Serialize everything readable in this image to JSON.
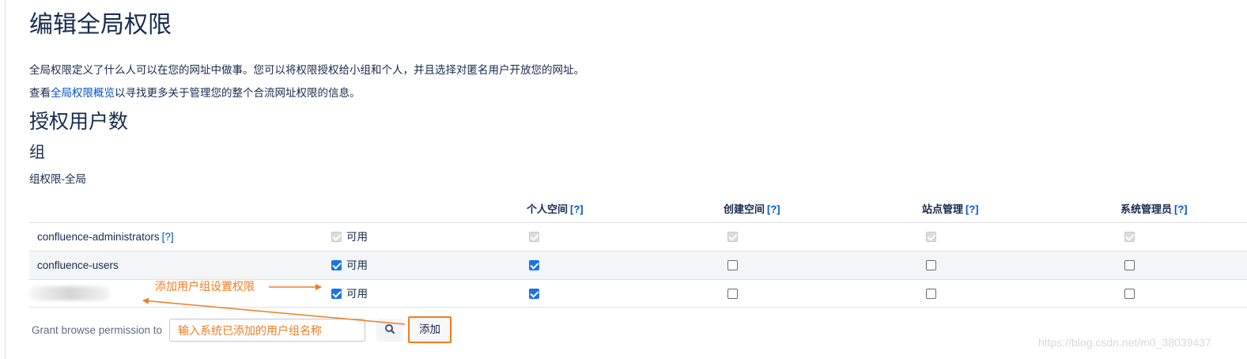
{
  "page": {
    "title": "编辑全局权限",
    "desc1": "全局权限定义了什么人可以在您的网址中做事。您可以将权限授权给小组和个人，并且选择对匿名用户开放您的网址。",
    "desc2_prefix": "查看",
    "desc2_link": "全局权限概览",
    "desc2_suffix": "以寻找更多关于管理您的整个合流网址权限的信息。",
    "section_title": "授权用户数",
    "group_title": "组",
    "group_subtitle": "组权限-全局"
  },
  "columns": [
    {
      "label": "个人空间",
      "help": "[?]"
    },
    {
      "label": "创建空间",
      "help": "[?]"
    },
    {
      "label": "站点管理",
      "help": "[?]"
    },
    {
      "label": "系统管理员",
      "help": "[?]"
    }
  ],
  "rows": [
    {
      "name": "confluence-administrators",
      "help": "[?]",
      "available_label": "可用",
      "available": "disabled-checked",
      "personal_space": "disabled-checked",
      "create_space": "disabled-checked",
      "site_admin": "disabled-checked",
      "sys_admin": "disabled-checked"
    },
    {
      "name": "confluence-users",
      "available_label": "可用",
      "available": "checked",
      "personal_space": "checked",
      "create_space": "unchecked",
      "site_admin": "unchecked",
      "sys_admin": "unchecked"
    },
    {
      "name": "",
      "blurred": true,
      "available_label": "可用",
      "available": "checked",
      "personal_space": "checked",
      "create_space": "unchecked",
      "site_admin": "unchecked",
      "sys_admin": "unchecked"
    }
  ],
  "grant": {
    "label": "Grant browse permission to",
    "placeholder": "输入系统已添加的用户组名称",
    "search_icon": "search-icon",
    "add_label": "添加"
  },
  "annotation": {
    "text": "添加用户组设置权限",
    "color": "#f37b20"
  },
  "watermark": "https://blog.csdn.net/m0_38039437",
  "colors": {
    "link": "#0052cc",
    "accent": "#f37b20",
    "checkbox": "#1a73e8"
  }
}
